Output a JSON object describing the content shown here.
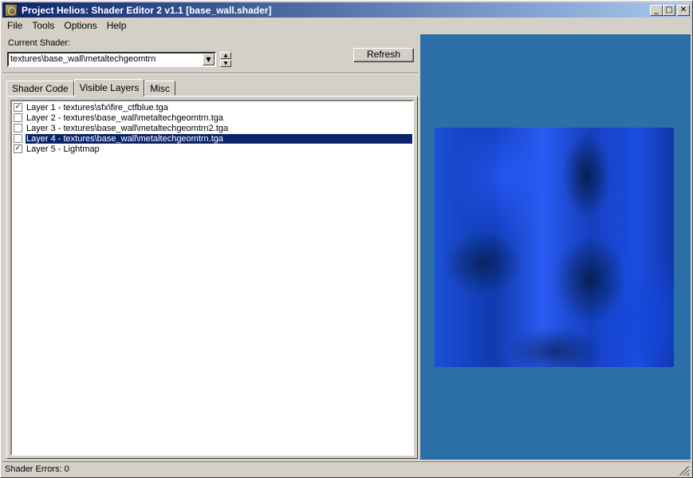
{
  "window": {
    "title": "Project Helios: Shader Editor 2 v1.1 [base_wall.shader]",
    "minimize": "_",
    "maximize": "□",
    "close": "✕"
  },
  "menu": [
    "File",
    "Tools",
    "Options",
    "Help"
  ],
  "shader": {
    "label": "Current Shader:",
    "value": "textures\\base_wall\\metaltechgeomtrn",
    "refresh_label": "Refresh"
  },
  "tabs": [
    "Shader Code",
    "Visible Layers",
    "Misc"
  ],
  "active_tab": "Visible Layers",
  "layers": [
    {
      "label": "Layer 1 - textures\\sfx\\fire_ctfblue.tga",
      "checked": true,
      "selected": false
    },
    {
      "label": "Layer 2 - textures\\base_wall\\metaltechgeomtrn.tga",
      "checked": false,
      "selected": false
    },
    {
      "label": "Layer 3 - textures\\base_wall\\metaltechgeomtrn2.tga",
      "checked": false,
      "selected": false
    },
    {
      "label": "Layer 4 - textures\\base_wall\\metaltechgeomtrn.tga",
      "checked": false,
      "selected": true
    },
    {
      "label": "Layer 5 - Lightmap",
      "checked": true,
      "selected": false
    }
  ],
  "status": "Shader Errors: 0",
  "colors": {
    "titlebar": "#0a246a",
    "preview_bg": "#2a6fa8",
    "selection": "#0a246a"
  }
}
